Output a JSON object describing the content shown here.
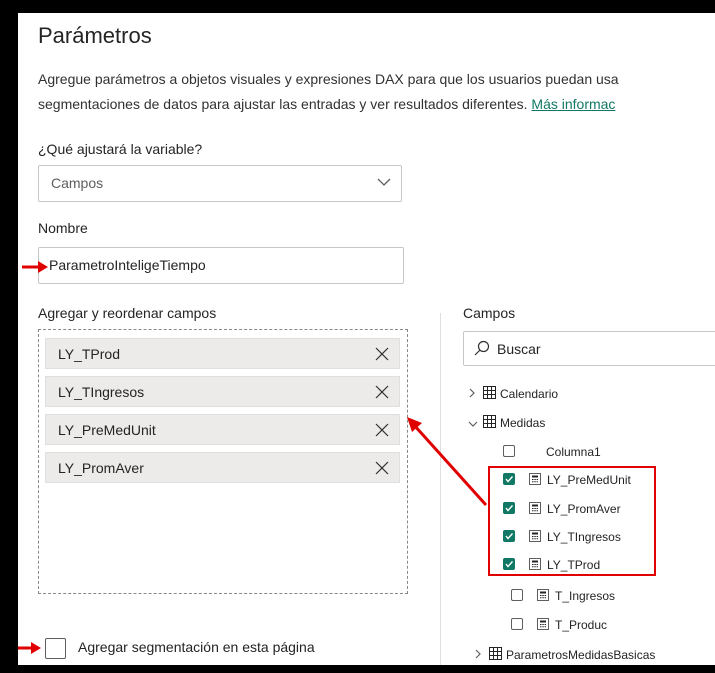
{
  "dialog": {
    "title": "Parámetros",
    "description_line1": "Agregue parámetros a objetos visuales y expresiones DAX para que los usuarios puedan usa",
    "description_line2": "segmentaciones de datos para ajustar las entradas y ver resultados diferentes.",
    "description_link": "Más informac"
  },
  "variable": {
    "label": "¿Qué ajustará la variable?",
    "selected": "Campos",
    "icon": "chevron-down-icon"
  },
  "name": {
    "label": "Nombre",
    "value": "ParametroInteligeTiempo"
  },
  "reorder": {
    "label": "Agregar y reordenar campos",
    "items": [
      "LY_TProd",
      "LY_TIngresos",
      "LY_PreMedUnit",
      "LY_PromAver"
    ]
  },
  "fields": {
    "label": "Campos",
    "search_placeholder": "Buscar",
    "tree": {
      "calendario": "Calendario",
      "medidas": "Medidas",
      "columna1": "Columna1",
      "ly_premedunit": "LY_PreMedUnit",
      "ly_promaver": "LY_PromAver",
      "ly_tingresos": "LY_TIngresos",
      "ly_tprod": "LY_TProd",
      "t_ingresos": "T_Ingresos",
      "t_produc": "T_Produc",
      "parametros": "ParametrosMedidasBasicas"
    }
  },
  "slicer": {
    "label": "Agregar segmentación en esta página",
    "checked": false
  },
  "colors": {
    "accent": "#117865",
    "annotation": "#e00000",
    "frame": "#000000"
  }
}
